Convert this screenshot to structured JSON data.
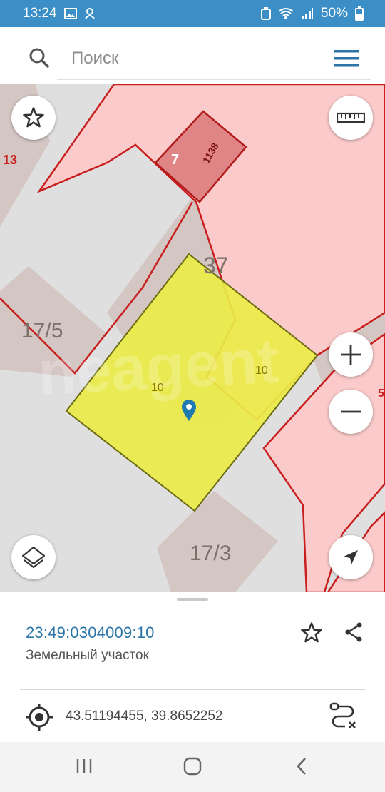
{
  "status_bar": {
    "time": "13:24",
    "battery": "50%",
    "icons": [
      "image-icon",
      "notification-icon",
      "battery-saver-icon",
      "wifi-icon",
      "signal-icon",
      "battery-icon"
    ]
  },
  "search": {
    "placeholder": "Поиск"
  },
  "map": {
    "labels": {
      "plot_13": "13",
      "plot_7": "7",
      "plot_1138": "1138",
      "plot_37": "37",
      "plot_17_5": "17/5",
      "plot_17_3": "17/3",
      "plot_5": "5",
      "edge_left": "10",
      "edge_right": "10"
    },
    "watermark": "neagent",
    "colors": {
      "selected_fill": "#eaec48",
      "cadastral_fill": "#fbcaca",
      "cadastral_border": "#c81e1e",
      "building": "#d4c6c2",
      "pin": "#1f7ab0"
    }
  },
  "parcel": {
    "cadastral_number": "23:49:0304009:10",
    "type": "Земельный участок",
    "coordinates": "43.51194455, 39.8652252"
  },
  "colors": {
    "accent": "#3c8fc6",
    "link": "#2b74a8"
  }
}
